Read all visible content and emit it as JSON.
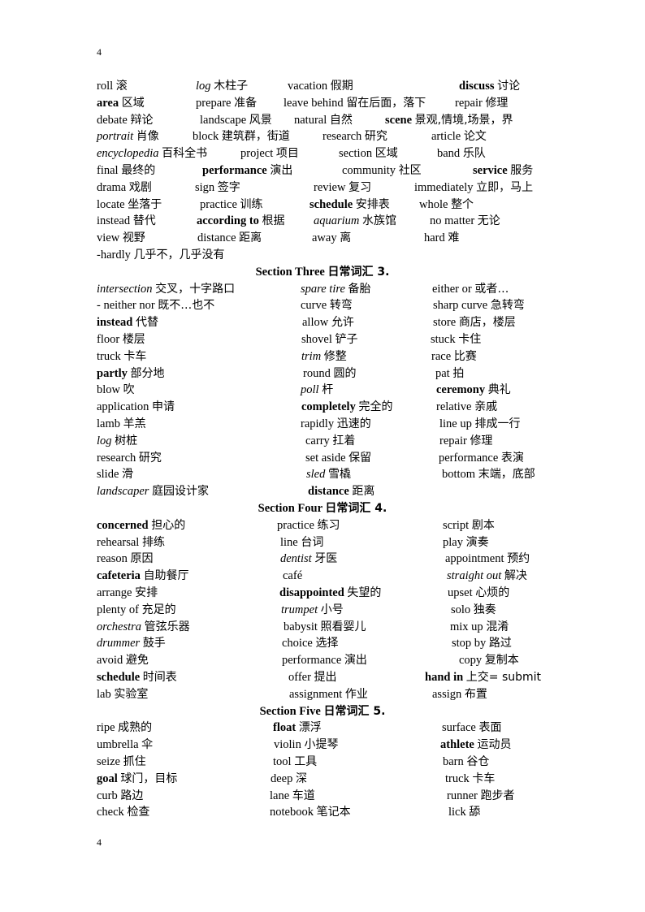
{
  "page_number_top": "4",
  "page_number_bottom": "4",
  "blocks": [
    {
      "type": "row",
      "entries": [
        {
          "en": "roll",
          "zh": "滚",
          "style": ""
        },
        {
          "en": "log",
          "zh": "木柱子",
          "style": "i"
        },
        {
          "en": "vacation",
          "zh": "假期",
          "style": ""
        },
        {
          "en": "discuss",
          "zh": "讨论",
          "style": "b"
        }
      ]
    },
    {
      "type": "row",
      "entries": [
        {
          "en": "area",
          "zh": "区域",
          "style": "b"
        },
        {
          "en": "prepare",
          "zh": "准备",
          "style": ""
        },
        {
          "en": "leave behind",
          "zh": "留在后面，落下",
          "style": ""
        },
        {
          "en": "repair",
          "zh": "修理",
          "style": ""
        }
      ]
    },
    {
      "type": "row",
      "entries": [
        {
          "en": "debate",
          "zh": "辩论",
          "style": ""
        },
        {
          "en": "landscape",
          "zh": "风景",
          "style": ""
        },
        {
          "en": "natural",
          "zh": "自然",
          "style": ""
        },
        {
          "en": "scene",
          "zh": "景观,情境,场景，界",
          "style": "b"
        }
      ]
    },
    {
      "type": "row",
      "entries": [
        {
          "en": "portrait",
          "zh": "肖像",
          "style": "i"
        },
        {
          "en": "block",
          "zh": "建筑群，街道",
          "style": ""
        },
        {
          "en": "research",
          "zh": "研究",
          "style": ""
        },
        {
          "en": "article",
          "zh": "论文",
          "style": ""
        }
      ]
    },
    {
      "type": "row",
      "entries": [
        {
          "en": "encyclopedia",
          "zh": "百科全书",
          "style": "i"
        },
        {
          "en": "project",
          "zh": "项目",
          "style": ""
        },
        {
          "en": "section",
          "zh": "区域",
          "style": ""
        },
        {
          "en": "band",
          "zh": "乐队",
          "style": ""
        }
      ]
    },
    {
      "type": "row",
      "entries": [
        {
          "en": "final",
          "zh": "最终的",
          "style": ""
        },
        {
          "en": "performance",
          "zh": "演出",
          "style": "b"
        },
        {
          "en": "community",
          "zh": "社区",
          "style": ""
        },
        {
          "en": "service",
          "zh": "服务",
          "style": "b"
        }
      ]
    },
    {
      "type": "row",
      "entries": [
        {
          "en": "drama",
          "zh": "戏剧",
          "style": ""
        },
        {
          "en": "sign",
          "zh": "签字",
          "style": ""
        },
        {
          "en": "review",
          "zh": "复习",
          "style": ""
        },
        {
          "en": "immediately",
          "zh": "立即，马上",
          "style": ""
        }
      ]
    },
    {
      "type": "row",
      "entries": [
        {
          "en": "locate",
          "zh": "坐落于",
          "style": ""
        },
        {
          "en": "practice",
          "zh": "训练",
          "style": ""
        },
        {
          "en": "schedule",
          "zh": "安排表",
          "style": "b"
        },
        {
          "en": "whole",
          "zh": "整个",
          "style": ""
        }
      ]
    },
    {
      "type": "row",
      "entries": [
        {
          "en": "instead",
          "zh": "替代",
          "style": ""
        },
        {
          "en": "according to",
          "zh": "根据",
          "style": "b"
        },
        {
          "en": "aquarium",
          "zh": "水族馆",
          "style": "i"
        },
        {
          "en": "no matter",
          "zh": "无论",
          "style": ""
        }
      ]
    },
    {
      "type": "row",
      "entries": [
        {
          "en": "view",
          "zh": "视野",
          "style": ""
        },
        {
          "en": "distance",
          "zh": "距离",
          "style": ""
        },
        {
          "en": "away",
          "zh": "离",
          "style": ""
        },
        {
          "en": "hard",
          "zh": "难",
          "style": ""
        }
      ]
    },
    {
      "type": "row",
      "entries": [
        {
          "en": "-hardly",
          "zh": "几乎不，几乎没有",
          "style": ""
        }
      ]
    },
    {
      "type": "header",
      "en": "Section Three",
      "zh": "日常词汇 3."
    },
    {
      "type": "row",
      "entries": [
        {
          "en": "intersection",
          "zh": "交叉，十字路口",
          "style": "i"
        },
        {
          "en": "spare tire",
          "zh": "备胎",
          "style": "i"
        },
        {
          "en": "either or",
          "zh": "或者…",
          "style": ""
        }
      ]
    },
    {
      "type": "row",
      "entries": [
        {
          "en": "-    neither nor",
          "zh": "既不…也不",
          "style": ""
        },
        {
          "en": "curve",
          "zh": "转弯",
          "style": ""
        },
        {
          "en": "sharp curve",
          "zh": "急转弯",
          "style": ""
        }
      ]
    },
    {
      "type": "row",
      "entries": [
        {
          "en": "instead",
          "zh": "代替",
          "style": "b"
        },
        {
          "en": "allow",
          "zh": "允许",
          "style": ""
        },
        {
          "en": "store",
          "zh": "商店，楼层",
          "style": ""
        }
      ]
    },
    {
      "type": "row",
      "entries": [
        {
          "en": "floor",
          "zh": "楼层",
          "style": ""
        },
        {
          "en": "shovel",
          "zh": "铲子",
          "style": ""
        },
        {
          "en": "stuck",
          "zh": "卡住",
          "style": ""
        }
      ]
    },
    {
      "type": "row",
      "entries": [
        {
          "en": "truck",
          "zh": "卡车",
          "style": ""
        },
        {
          "en": "trim",
          "zh": "修整",
          "style": "i"
        },
        {
          "en": "race",
          "zh": "比赛",
          "style": ""
        }
      ]
    },
    {
      "type": "row",
      "entries": [
        {
          "en": "partly",
          "zh": "部分地",
          "style": "b"
        },
        {
          "en": "round",
          "zh": "圆的",
          "style": ""
        },
        {
          "en": "pat",
          "zh": "拍",
          "style": ""
        }
      ]
    },
    {
      "type": "row",
      "entries": [
        {
          "en": "blow",
          "zh": "吹",
          "style": ""
        },
        {
          "en": "poll",
          "zh": "杆",
          "style": "i"
        },
        {
          "en": "ceremony",
          "zh": "典礼",
          "style": "b"
        }
      ]
    },
    {
      "type": "row",
      "entries": [
        {
          "en": "application",
          "zh": "申请",
          "style": ""
        },
        {
          "en": "completely",
          "zh": "完全的",
          "style": "b"
        },
        {
          "en": "relative",
          "zh": "亲戚",
          "style": ""
        }
      ]
    },
    {
      "type": "row",
      "entries": [
        {
          "en": "lamb",
          "zh": "羊羔",
          "style": ""
        },
        {
          "en": "rapidly",
          "zh": "迅速的",
          "style": ""
        },
        {
          "en": "line up",
          "zh": "排成一行",
          "style": ""
        }
      ]
    },
    {
      "type": "row",
      "entries": [
        {
          "en": "log",
          "zh": "树桩",
          "style": "i"
        },
        {
          "en": "carry",
          "zh": "扛着",
          "style": ""
        },
        {
          "en": "repair",
          "zh": "修理",
          "style": ""
        }
      ]
    },
    {
      "type": "row",
      "entries": [
        {
          "en": "research",
          "zh": "研究",
          "style": ""
        },
        {
          "en": "set aside",
          "zh": "保留",
          "style": ""
        },
        {
          "en": "performance",
          "zh": "表演",
          "style": ""
        }
      ]
    },
    {
      "type": "row",
      "entries": [
        {
          "en": "slide",
          "zh": "滑",
          "style": ""
        },
        {
          "en": "sled",
          "zh": "雪橇",
          "style": "i"
        },
        {
          "en": "bottom",
          "zh": "末端，底部",
          "style": ""
        }
      ]
    },
    {
      "type": "row",
      "entries": [
        {
          "en": "landscaper",
          "zh": "庭园设计家",
          "style": "i"
        },
        {
          "en": "distance",
          "zh": "距离",
          "style": "b"
        }
      ]
    },
    {
      "type": "header",
      "en": "Section Four",
      "zh": "日常词汇 4."
    },
    {
      "type": "row",
      "entries": [
        {
          "en": "concerned",
          "zh": "担心的",
          "style": "b"
        },
        {
          "en": "practice",
          "zh": "练习",
          "style": ""
        },
        {
          "en": "script",
          "zh": "剧本",
          "style": ""
        }
      ]
    },
    {
      "type": "row",
      "entries": [
        {
          "en": "rehearsal",
          "zh": "排练",
          "style": ""
        },
        {
          "en": "line",
          "zh": "台词",
          "style": ""
        },
        {
          "en": "play",
          "zh": "演奏",
          "style": ""
        }
      ]
    },
    {
      "type": "row",
      "entries": [
        {
          "en": "reason",
          "zh": "原因",
          "style": ""
        },
        {
          "en": "dentist",
          "zh": "牙医",
          "style": "i"
        },
        {
          "en": "appointment",
          "zh": "预约",
          "style": ""
        }
      ]
    },
    {
      "type": "row",
      "entries": [
        {
          "en": "cafeteria",
          "zh": "自助餐厅",
          "style": "b"
        },
        {
          "en": "café",
          "zh": "",
          "style": ""
        },
        {
          "en": "straight out",
          "zh": "解决",
          "style": "i"
        }
      ]
    },
    {
      "type": "row",
      "entries": [
        {
          "en": "arrange",
          "zh": "安排",
          "style": ""
        },
        {
          "en": "disappointed",
          "zh": "失望的",
          "style": "b"
        },
        {
          "en": "upset",
          "zh": "心烦的",
          "style": ""
        }
      ]
    },
    {
      "type": "row",
      "entries": [
        {
          "en": "plenty of",
          "zh": "充足的",
          "style": ""
        },
        {
          "en": "trumpet",
          "zh": "小号",
          "style": "i"
        },
        {
          "en": "solo",
          "zh": "独奏",
          "style": ""
        }
      ]
    },
    {
      "type": "row",
      "entries": [
        {
          "en": "orchestra",
          "zh": "管弦乐器",
          "style": "i"
        },
        {
          "en": "babysit",
          "zh": "照看婴儿",
          "style": ""
        },
        {
          "en": "mix up",
          "zh": "混淆",
          "style": ""
        }
      ]
    },
    {
      "type": "row",
      "entries": [
        {
          "en": "drummer",
          "zh": "鼓手",
          "style": "i"
        },
        {
          "en": "choice",
          "zh": "选择",
          "style": ""
        },
        {
          "en": "stop by",
          "zh": "路过",
          "style": ""
        }
      ]
    },
    {
      "type": "row",
      "entries": [
        {
          "en": "avoid",
          "zh": "避免",
          "style": ""
        },
        {
          "en": "performance",
          "zh": "演出",
          "style": ""
        },
        {
          "en": "copy",
          "zh": "复制本",
          "style": ""
        }
      ]
    },
    {
      "type": "row",
      "entries": [
        {
          "en": "schedule",
          "zh": "时间表",
          "style": "b"
        },
        {
          "en": "offer",
          "zh": "提出",
          "style": ""
        },
        {
          "en": "hand in",
          "zh": "上交= submit",
          "style": "b"
        }
      ]
    },
    {
      "type": "row",
      "entries": [
        {
          "en": "lab",
          "zh": "实验室",
          "style": ""
        },
        {
          "en": "assignment",
          "zh": "作业",
          "style": ""
        },
        {
          "en": "assign",
          "zh": "布置",
          "style": ""
        }
      ]
    },
    {
      "type": "header",
      "en": "Section Five",
      "zh": "日常词汇  5."
    },
    {
      "type": "row",
      "entries": [
        {
          "en": "ripe",
          "zh": "成熟的",
          "style": ""
        },
        {
          "en": "float",
          "zh": "漂浮",
          "style": "b"
        },
        {
          "en": "surface",
          "zh": "表面",
          "style": ""
        }
      ]
    },
    {
      "type": "row",
      "entries": [
        {
          "en": "umbrella",
          "zh": "伞",
          "style": ""
        },
        {
          "en": "violin",
          "zh": "小提琴",
          "style": ""
        },
        {
          "en": "athlete",
          "zh": "运动员",
          "style": "b"
        }
      ]
    },
    {
      "type": "row",
      "entries": [
        {
          "en": "seize",
          "zh": "抓住",
          "style": ""
        },
        {
          "en": "tool",
          "zh": "工具",
          "style": ""
        },
        {
          "en": "barn",
          "zh": "谷仓",
          "style": ""
        }
      ]
    },
    {
      "type": "row",
      "entries": [
        {
          "en": "goal",
          "zh": "球门，目标",
          "style": "b"
        },
        {
          "en": "deep",
          "zh": "深",
          "style": ""
        },
        {
          "en": "truck",
          "zh": "卡车",
          "style": ""
        }
      ]
    },
    {
      "type": "row",
      "entries": [
        {
          "en": "curb",
          "zh": "路边",
          "style": ""
        },
        {
          "en": "lane",
          "zh": "车道",
          "style": ""
        },
        {
          "en": "runner",
          "zh": "跑步者",
          "style": ""
        }
      ]
    },
    {
      "type": "row",
      "entries": [
        {
          "en": "check",
          "zh": "检查",
          "style": ""
        },
        {
          "en": "notebook",
          "zh": "笔记本",
          "style": ""
        },
        {
          "en": "lick",
          "zh": "舔",
          "style": ""
        }
      ]
    }
  ]
}
